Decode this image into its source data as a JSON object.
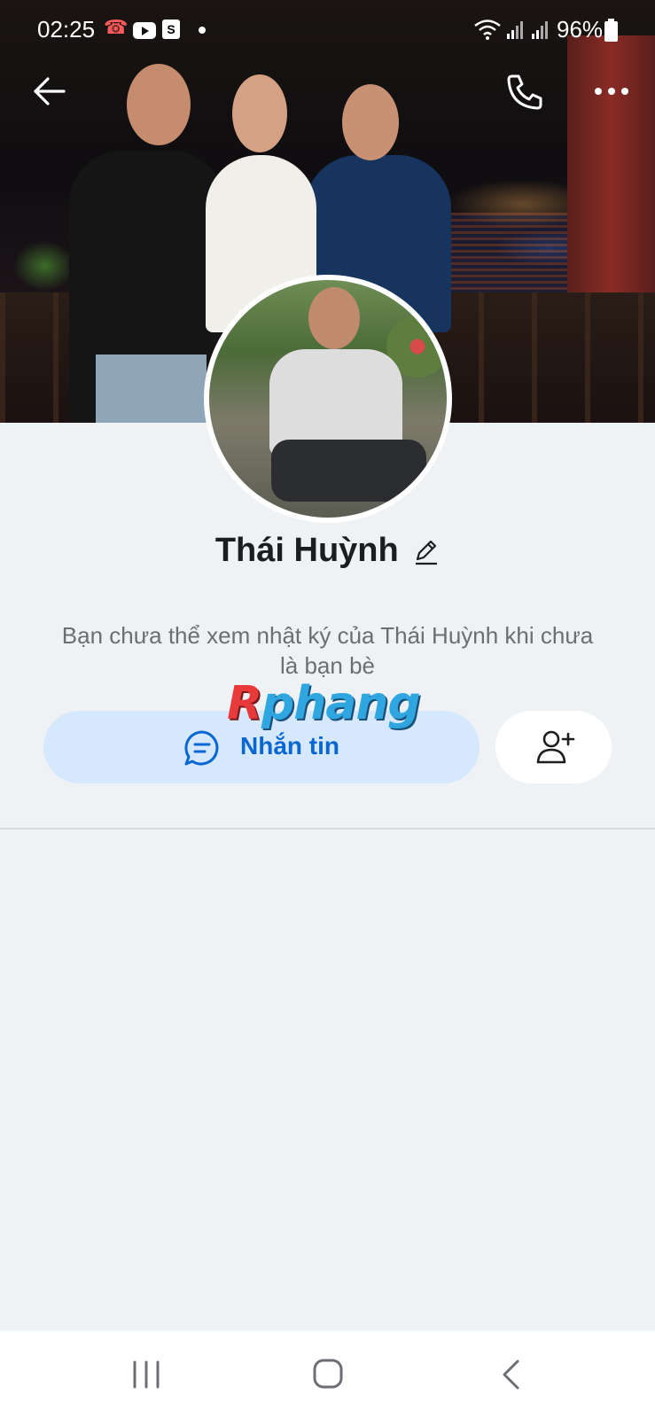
{
  "status_bar": {
    "time": "02:25",
    "battery": "96%",
    "icons": [
      "missed-call-icon",
      "youtube-icon",
      "shopee-icon",
      "dot-icon",
      "wifi-icon",
      "signal-icon",
      "signal-icon",
      "battery-icon"
    ]
  },
  "header": {
    "back_icon": "arrow-left-icon",
    "call_icon": "phone-icon",
    "more_icon": "more-horizontal-icon"
  },
  "profile": {
    "name": "Thái Huỳnh",
    "edit_icon": "pencil-icon",
    "notice": "Bạn chưa thể xem nhật ký của Thái Huỳnh khi chưa là bạn bè"
  },
  "actions": {
    "message_label": "Nhắn tin",
    "message_icon": "chat-bubble-icon",
    "add_friend_icon": "add-user-icon"
  },
  "watermark": {
    "first": "R",
    "rest": "phang"
  },
  "nav_bar": {
    "recent_icon": "recent-apps-icon",
    "home_icon": "home-icon",
    "back_icon": "back-chevron-icon"
  },
  "colors": {
    "accent": "#0a67d1",
    "message_button_bg": "#d5e8fd",
    "page_bg": "#eff2f4"
  }
}
